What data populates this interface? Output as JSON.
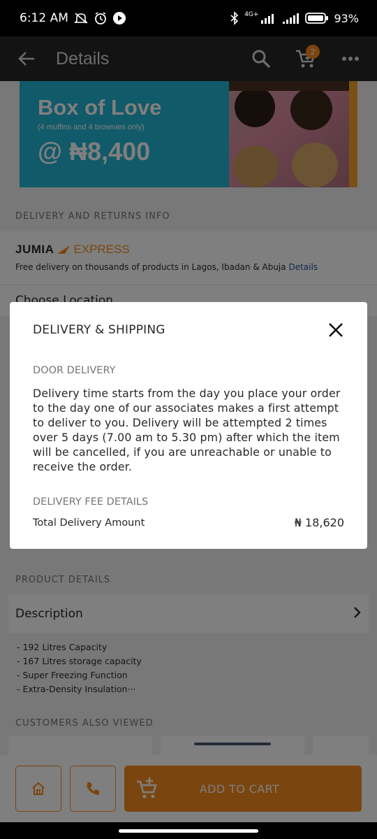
{
  "status_bar": {
    "time": "6:12 AM",
    "network": "4G+",
    "battery": "93%"
  },
  "app_bar": {
    "title": "Details",
    "cart_count": "2"
  },
  "banner": {
    "headline": "Box of Love",
    "sub": "(4 muffins and 4 brownies only)",
    "price": "@ ₦8,400"
  },
  "delivery": {
    "section_label": "DELIVERY AND RETURNS INFO",
    "logo_brand": "JUMIA",
    "logo_express": "EXPRESS",
    "free_text": "Free delivery on thousands of products in Lagos, Ibadan & Abuja",
    "free_link": "Details",
    "choose_location": "Choose Location"
  },
  "product_details": {
    "section_label": "PRODUCT DETAILS",
    "description_label": "Description",
    "bullets": [
      "- 192 Litres Capacity",
      "- 167 Litres storage capacity",
      "- Super Freezing Function",
      "- Extra-Density Insulation···"
    ]
  },
  "customers_also_viewed": {
    "section_label": "CUSTOMERS ALSO VIEWED"
  },
  "bottom_bar": {
    "add_to_cart": "ADD TO CART"
  },
  "modal": {
    "title": "DELIVERY & SHIPPING",
    "door_label": "DOOR DELIVERY",
    "door_text": "Delivery time starts from the day you place your order to the day one of our associates makes a first attempt to deliver to you. Delivery will be attempted 2 times over 5 days (7.00 am to 5.30 pm) after which the item will be cancelled, if you are unreachable or unable to receive the order.",
    "fee_label": "DELIVERY FEE DETAILS",
    "total_label": "Total Delivery Amount",
    "total_amount": "₦ 18,620"
  },
  "colors": {
    "accent": "#f68b1e",
    "appbar": "#262626",
    "banner_blue": "#23b5d3",
    "link": "#264996"
  },
  "icons": [
    "back-arrow-icon",
    "search-icon",
    "cart-icon",
    "more-icon",
    "close-icon",
    "chevron-right-icon",
    "home-icon",
    "phone-icon",
    "add-cart-icon"
  ]
}
